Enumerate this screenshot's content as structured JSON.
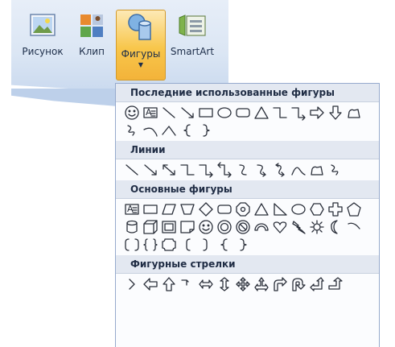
{
  "ribbon": {
    "tools": [
      {
        "label": "Рисунок",
        "icon": "picture-icon"
      },
      {
        "label": "Клип",
        "icon": "clipart-icon"
      },
      {
        "label": "Фигуры",
        "icon": "shapes-icon",
        "active": true
      },
      {
        "label": "SmartArt",
        "icon": "smartart-icon"
      }
    ],
    "accent_color": "#f8c64a"
  },
  "gallery": {
    "sections": [
      {
        "title": "Последние использованные фигуры",
        "shapes": [
          "smiley",
          "textbox",
          "line",
          "arrow-line",
          "rectangle",
          "oval",
          "rounded-rectangle",
          "triangle",
          "elbow-connector",
          "elbow-arrow-connector",
          "right-arrow",
          "down-arrow",
          "freeform",
          "scribble",
          "curve",
          "arc",
          "left-brace",
          "right-brace"
        ]
      },
      {
        "title": "Линии",
        "shapes": [
          "line",
          "arrow-line",
          "double-arrow-line",
          "elbow-connector",
          "elbow-arrow-connector",
          "elbow-double-arrow",
          "curved-connector",
          "curved-arrow",
          "curved-double-arrow",
          "curve",
          "freeform",
          "scribble"
        ]
      },
      {
        "title": "Основные фигуры",
        "shapes": [
          "textbox",
          "rectangle",
          "parallelogram",
          "trapezoid",
          "diamond",
          "rounded-rectangle",
          "octagon",
          "triangle",
          "right-triangle",
          "oval",
          "hexagon",
          "cross",
          "pentagon",
          "can",
          "cube",
          "bevel",
          "folded-corner",
          "smiley",
          "donut",
          "no-symbol",
          "block-arc",
          "heart",
          "lightning",
          "sun",
          "moon",
          "arc",
          "bracket-pair",
          "brace-pair",
          "plaque",
          "left-bracket",
          "right-bracket",
          "left-brace",
          "right-brace"
        ]
      },
      {
        "title": "Фигурные стрелки",
        "shapes": [
          "chevron-right",
          "left-arrow",
          "up-arrow",
          "bent-up",
          "left-right-arrow",
          "up-down-arrow",
          "quad-arrow",
          "left-right-up",
          "bent-arrow",
          "u-turn",
          "left-up",
          "bent-up-arrow"
        ]
      }
    ]
  }
}
